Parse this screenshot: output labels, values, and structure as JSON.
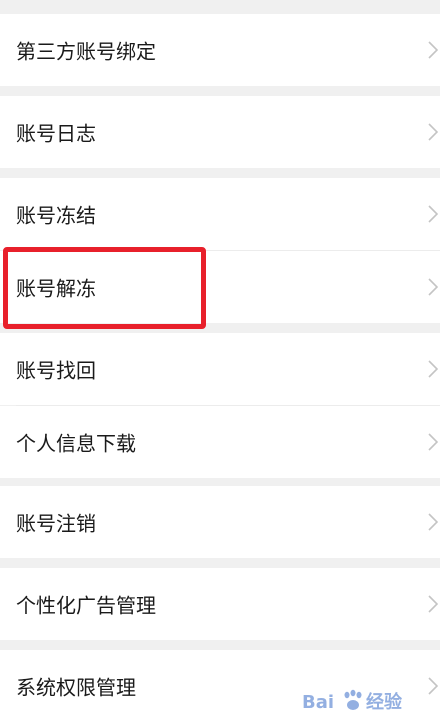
{
  "settings_list": {
    "items": [
      {
        "label": "第三方账号绑定"
      },
      {
        "label": "账号日志"
      },
      {
        "label": "账号冻结"
      },
      {
        "label": "账号解冻"
      },
      {
        "label": "账号找回"
      },
      {
        "label": "个人信息下载"
      },
      {
        "label": "账号注销"
      },
      {
        "label": "个性化广告管理"
      },
      {
        "label": "系统权限管理"
      }
    ]
  },
  "colors": {
    "background": "#f0f0f0",
    "row": "#ffffff",
    "text": "#1a1a1a",
    "highlight": "#e8202b"
  },
  "icons": {
    "chevron": "chevron-right-icon"
  },
  "watermark": {
    "text": "Baidu 经验"
  }
}
